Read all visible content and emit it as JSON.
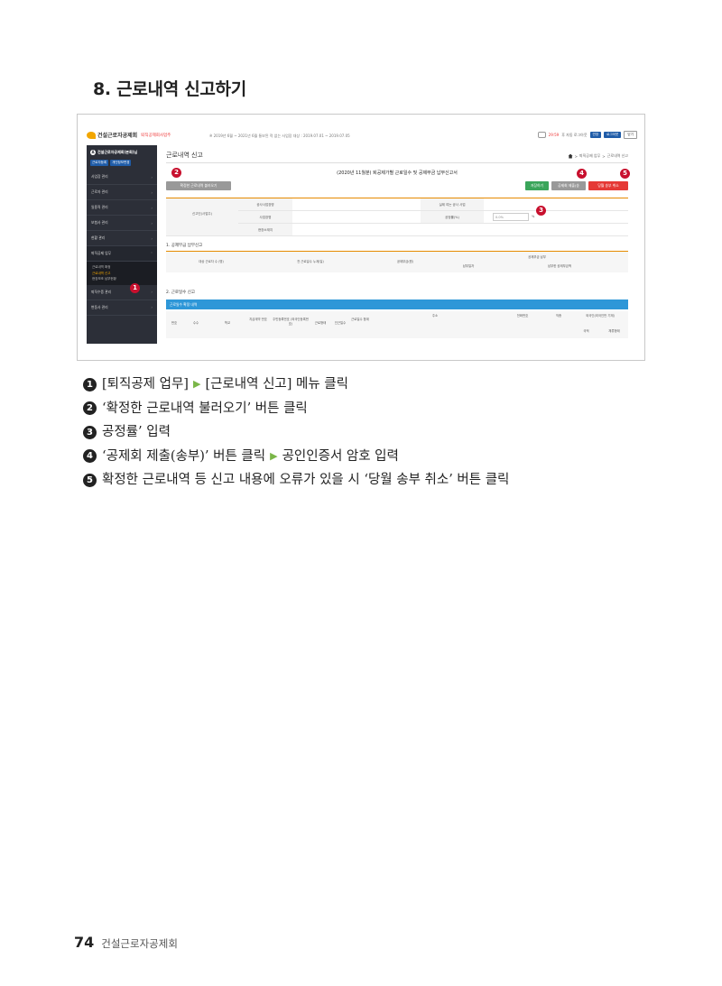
{
  "section_title": "8. 근로내역 신고하기",
  "screenshot": {
    "topbar": {
      "logo": "건설근로자공제회",
      "logo_sub": "퇴직공제회사업주",
      "notice": "※ 2019년 6월 ~ 2021년 6월 통보된 적 없는 사업장 대상 : 2019.07.01 ~ 2019.07.05",
      "time": "29:59",
      "time_suffix": "후 자동 로그아웃",
      "btn_extend": "연장",
      "btn_logout": "로그아웃",
      "btn_close": "닫기"
    },
    "sidebar": {
      "org": "건설근로자공제회(본회)님",
      "org_icon": "A",
      "btn1": "근로자등록",
      "btn2": "개인정보변경",
      "items": [
        {
          "label": "사업장 관리",
          "chevron": "›"
        },
        {
          "label": "근로자 관리",
          "chevron": "›"
        },
        {
          "label": "일용직 관리",
          "chevron": "›"
        },
        {
          "label": "보험사 관리",
          "chevron": "›"
        },
        {
          "label": "현황 관리",
          "chevron": "›"
        },
        {
          "label": "퇴직공제 업무",
          "chevron": "˅"
        }
      ],
      "sub_items": [
        "근로내역 확정",
        "근로내역 신고",
        "현장보조 납부현황"
      ],
      "items_after": [
        {
          "label": "퇴직수증 관리",
          "chevron": "›"
        },
        {
          "label": "변동사 관리",
          "chevron": "›"
        }
      ]
    },
    "main": {
      "page_head": "근로내역 신고",
      "breadcrumb": [
        "퇴직공제 업무",
        "근로내역 신고"
      ],
      "crumb_sep": ">",
      "doc_title": "(2020년 11월분) 퇴공제가별 근로일수 및 공제부금 납부신고서",
      "btn_load": "확정한 근로내역 불러오기",
      "btn_save": "저장하기",
      "btn_submit": "공제회 제출(송부)",
      "btn_cancel": "당월 송부 취소",
      "info_left_label": "신고인(사업주)",
      "info_rows": [
        "공사사업장명",
        "사업장명",
        "현장소재지"
      ],
      "info_right": [
        "실제 여는 공사 사업",
        "공정률(%)"
      ],
      "rate_value": "0.0%",
      "rate_unit": "%",
      "section1": "1. 공제부금 납부신고",
      "grid1_cols": [
        "대상 근로자 수 (명)",
        "전 근로일수 누계(일)",
        "공제부금(원)",
        "공제부금 납부"
      ],
      "grid1_sub": [
        "납부일자",
        "납부한 공제부금액"
      ],
      "section2": "2. 근로일수 신고",
      "blue_bar": "근로일수 확정 내역",
      "grid2_cols": [
        "번호",
        "수수",
        "학교",
        "지급계약 번호",
        "주민등록번호 (외국인등록번호)",
        "근로형태",
        "인근일수",
        "근로일수 합계",
        "주소",
        "전화번호",
        "직종",
        "외국인(외국인만 기재)"
      ],
      "grid2_sub": [
        "국적",
        "체류형태"
      ]
    },
    "markers": [
      "1",
      "2",
      "3",
      "4",
      "5"
    ]
  },
  "steps": [
    {
      "num": "1",
      "parts": [
        "[퇴직공제 업무]",
        "[근로내역 신고] 메뉴 클릭"
      ]
    },
    {
      "num": "2",
      "parts": [
        "‘확정한 근로내역 불러오기’ 버튼 클릭"
      ]
    },
    {
      "num": "3",
      "parts": [
        "공정률’ 입력"
      ]
    },
    {
      "num": "4",
      "parts": [
        "‘공제회 제출(송부)’ 버튼 클릭",
        "공인인증서 암호 입력"
      ]
    },
    {
      "num": "5",
      "parts": [
        "확정한 근로내역 등 신고 내용에 오류가 있을 시 ‘당월 송부 취소’ 버튼 클릭"
      ]
    }
  ],
  "arrow_glyph": "▶",
  "footer": {
    "page": "74",
    "org": "건설근로자공제회"
  }
}
